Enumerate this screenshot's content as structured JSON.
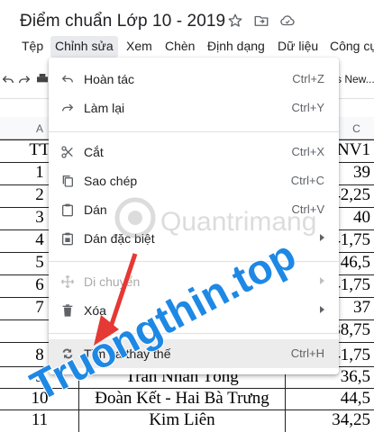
{
  "title_bar": {
    "title": "Điểm chuẩn Lớp 10 - 2019",
    "star_icon": "star-icon",
    "move_icon": "folder-move-icon",
    "cloud_icon": "cloud-status-icon"
  },
  "menu_bar": {
    "items": [
      "Tệp",
      "Chỉnh sửa",
      "Xem",
      "Chèn",
      "Định dạng",
      "Dữ liệu",
      "Công cụ"
    ],
    "active_index": 1
  },
  "toolbar": {
    "font_name": "s New..."
  },
  "columns": {
    "a": "A",
    "c": "C"
  },
  "sheet": {
    "header": {
      "tt": "TT",
      "score": "NV1"
    },
    "rows": [
      {
        "tt": "1",
        "name": "",
        "score": "39"
      },
      {
        "tt": "2",
        "name": "",
        "score": "42,25"
      },
      {
        "tt": "3",
        "name": "",
        "score": "40"
      },
      {
        "tt": "4",
        "name": "",
        "score": "41,75"
      },
      {
        "tt": "5",
        "name": "",
        "score": "46,5"
      },
      {
        "tt": "6",
        "name": "",
        "score": "41,75"
      },
      {
        "tt": "7",
        "name": "",
        "score": "37"
      },
      {
        "tt": "",
        "name": "",
        "score": "38,75"
      },
      {
        "tt": "8",
        "name": "",
        "score": "41,75"
      },
      {
        "tt": "9",
        "name": "Trần Nhân Tông",
        "score": "36,5"
      },
      {
        "tt": "10",
        "name": "Đoàn Kết - Hai Bà Trưng",
        "score": "44,5"
      },
      {
        "tt": "11",
        "name": "Kim Liên",
        "score": "34,25"
      }
    ]
  },
  "edit_menu": {
    "items": [
      {
        "label": "Hoàn tác",
        "shortcut": "Ctrl+Z",
        "icon": "undo-icon"
      },
      {
        "label": "Làm lại",
        "shortcut": "Ctrl+Y",
        "icon": "redo-icon"
      },
      {
        "label": "Cắt",
        "shortcut": "Ctrl+X",
        "icon": "scissors-icon"
      },
      {
        "label": "Sao chép",
        "shortcut": "Ctrl+C",
        "icon": "copy-icon"
      },
      {
        "label": "Dán",
        "shortcut": "Ctrl+V",
        "icon": "clipboard-icon"
      },
      {
        "label": "Dán đặc biệt",
        "shortcut": "",
        "icon": "clipboard-special-icon"
      },
      {
        "label": "Di chuyển",
        "shortcut": "",
        "icon": "move-arrows-icon"
      },
      {
        "label": "Xóa",
        "shortcut": "",
        "icon": "trash-icon"
      },
      {
        "label": "Tìm và thay thế",
        "shortcut": "Ctrl+H",
        "icon": "find-replace-icon"
      }
    ]
  },
  "watermark": {
    "brand": "Truongthin.top",
    "site": "Quantrimang"
  },
  "colors": {
    "menu_highlight": "#ececec",
    "active_menu_bg": "#e8eaed",
    "watermark_blue": "#1e88e5",
    "watermark_red": "#e53935"
  }
}
